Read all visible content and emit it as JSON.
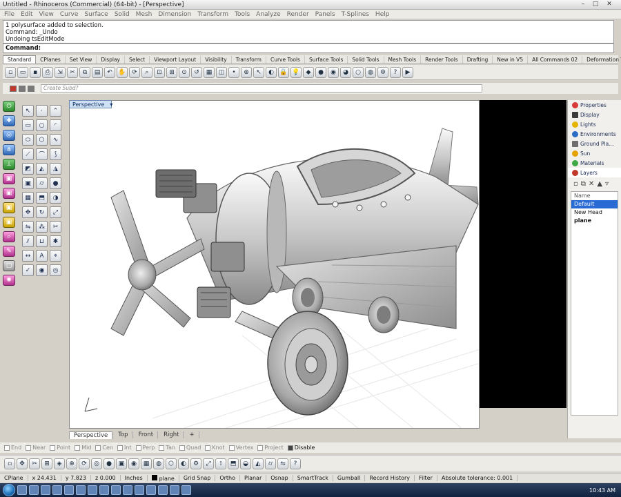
{
  "titlebar": {
    "title": "Untitled - Rhinoceros (Commercial) (64-bit) - [Perspective]"
  },
  "menubar": {
    "items": [
      "File",
      "Edit",
      "View",
      "Curve",
      "Surface",
      "Solid",
      "Mesh",
      "Dimension",
      "Transform",
      "Tools",
      "Analyze",
      "Render",
      "Panels",
      "T-Splines",
      "Help"
    ]
  },
  "command": {
    "history": [
      "1 polysurface added to selection.",
      "Command: _Undo",
      "Undoing tsEditMode"
    ],
    "prompt": "Command:"
  },
  "toolbar_tabs": [
    "Standard",
    "CPlanes",
    "Set View",
    "Display",
    "Select",
    "Viewport Layout",
    "Visibility",
    "Transform",
    "Curve Tools",
    "Surface Tools",
    "Solid Tools",
    "Mesh Tools",
    "Render Tools",
    "Drafting",
    "New in V5",
    "All Commands 02",
    "Deformation Tools"
  ],
  "layerbar": {
    "prompt_placeholder": "Create Subd?"
  },
  "viewport": {
    "active_tab": "Perspective",
    "tabs": [
      "Perspective",
      "Top",
      "Front",
      "Right"
    ],
    "add_tab": "+"
  },
  "panels": {
    "items": [
      {
        "label": "Properties",
        "color": "#d83a3a"
      },
      {
        "label": "Display",
        "color": "#3a3a3a"
      },
      {
        "label": "Lights",
        "color": "#e4b400"
      },
      {
        "label": "Environments",
        "color": "#2b6cc4"
      },
      {
        "label": "Ground Pla...",
        "color": "#6e6e6e"
      },
      {
        "label": "Sun",
        "color": "#e4a200"
      },
      {
        "label": "Materials",
        "color": "#3fa845"
      },
      {
        "label": "Layers",
        "color": "#c0392b"
      }
    ],
    "layers_header": "Name",
    "layers": [
      {
        "name": "Default",
        "selected": true
      },
      {
        "name": "New Head",
        "selected": false
      },
      {
        "name": "plane",
        "selected": false
      }
    ]
  },
  "osnap": [
    {
      "label": "End",
      "on": false
    },
    {
      "label": "Near",
      "on": false
    },
    {
      "label": "Point",
      "on": false
    },
    {
      "label": "Mid",
      "on": false
    },
    {
      "label": "Cen",
      "on": false
    },
    {
      "label": "Int",
      "on": false
    },
    {
      "label": "Perp",
      "on": false
    },
    {
      "label": "Tan",
      "on": false
    },
    {
      "label": "Quad",
      "on": false
    },
    {
      "label": "Knot",
      "on": false
    },
    {
      "label": "Vertex",
      "on": false
    },
    {
      "label": "Project",
      "on": false
    },
    {
      "label": "Disable",
      "on": true
    }
  ],
  "status": {
    "cplane": "CPlane",
    "x": "x 24.431",
    "y": "y 7.823",
    "z": "z 0.000",
    "units": "Inches",
    "layer": "plane",
    "grid_snap": "Grid Snap",
    "ortho": "Ortho",
    "planar": "Planar",
    "osnap": "Osnap",
    "smarttrack": "SmartTrack",
    "gumball": "Gumball",
    "record_history": "Record History",
    "filter": "Filter",
    "tolerance": "Absolute tolerance: 0.001"
  },
  "taskbar": {
    "clock": "10:43 AM"
  }
}
